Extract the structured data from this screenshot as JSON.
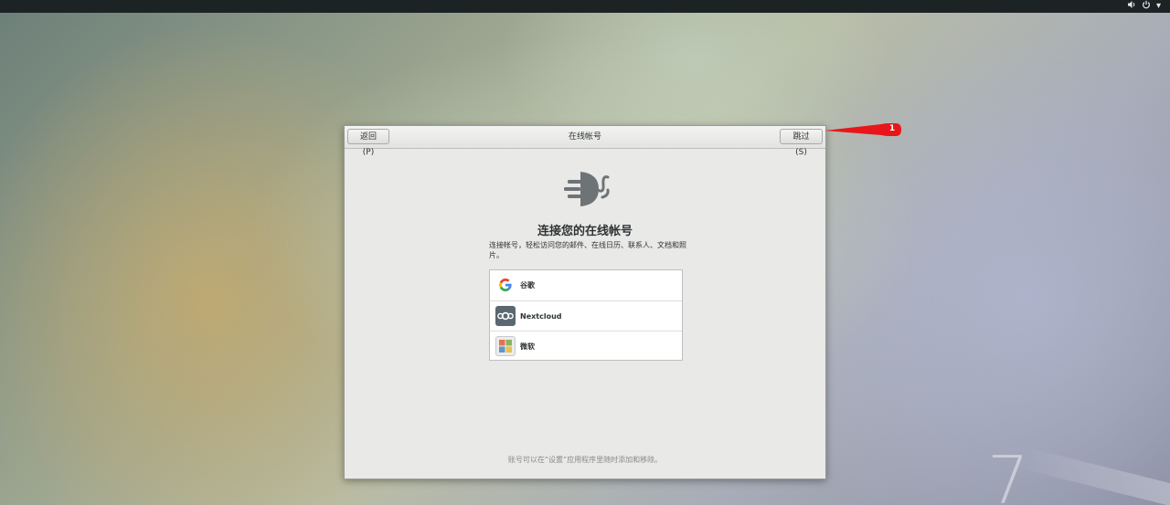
{
  "topbar": {
    "volume_icon": "volume-icon",
    "power_icon": "power-icon",
    "menu_arrow": "▾"
  },
  "dialog": {
    "back_label": "返回(P)",
    "title": "在线帐号",
    "skip_label": "跳过(S)",
    "heading": "连接您的在线帐号",
    "description": "连接帐号，轻松访问您的邮件、在线日历、联系人、文档和照片。",
    "accounts": [
      {
        "label": "谷歌",
        "icon": "google-icon"
      },
      {
        "label": "Nextcloud",
        "icon": "nextcloud-icon"
      },
      {
        "label": "微软",
        "icon": "microsoft-icon"
      }
    ],
    "footer_note": "账号可以在“设置”应用程序里随时添加和移除。"
  },
  "annotation": {
    "number": "1",
    "color": "#e8161b"
  },
  "watermark": {
    "text": "7"
  }
}
